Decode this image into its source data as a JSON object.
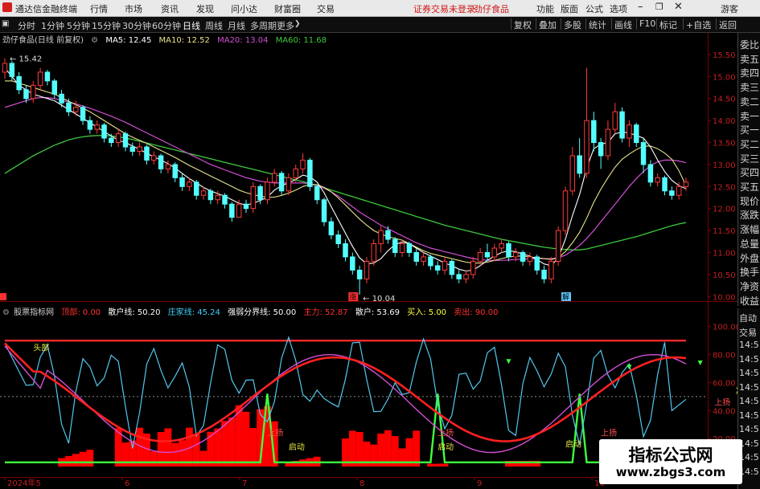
{
  "menubar": {
    "app_title": "通达信金融终端",
    "menus": [
      "行情",
      "市场",
      "资讯",
      "发现",
      "问小达",
      "财富圈",
      "交易"
    ],
    "login_notice": "证券交易未登录",
    "stock_label": "劲仔食品",
    "right_menus": [
      "功能",
      "版面",
      "公式",
      "选项"
    ],
    "window_icons": [
      "minimize-icon",
      "restore-icon",
      "close-icon"
    ],
    "guest": "游客"
  },
  "periodbar": {
    "periods": [
      "分时",
      "1分钟",
      "5分钟",
      "15分钟",
      "30分钟",
      "60分钟",
      "日线",
      "周线",
      "月线",
      "多周期",
      "更多"
    ],
    "active": "日线",
    "tools": [
      "复权",
      "叠加",
      "多股",
      "统计",
      "画线",
      "F10",
      "标记",
      "+自选",
      "返回"
    ]
  },
  "main_chart": {
    "stock_title": "劲仔食品(日线 前复权)",
    "ma": [
      {
        "label": "MA5: 12.45",
        "color": "#ffffff"
      },
      {
        "label": "MA10: 12.52",
        "color": "#e8e38a"
      },
      {
        "label": "MA20: 13.04",
        "color": "#d24fd4"
      },
      {
        "label": "MA60: 11.68",
        "color": "#3ec83e"
      }
    ],
    "price_ticks": [
      "15.50",
      "15.00",
      "14.50",
      "14.00",
      "13.50",
      "13.00",
      "12.50",
      "12.00",
      "11.50",
      "11.00",
      "10.50",
      "10.00"
    ],
    "price_range": [
      9.95,
      15.7
    ],
    "high_label": "15.42",
    "low_label": "10.04",
    "markers": [
      "涨",
      "解",
      "财"
    ],
    "candles": [
      [
        15.1,
        15.3,
        15.42,
        14.95
      ],
      [
        15.3,
        15.0,
        15.35,
        14.9
      ],
      [
        15.0,
        14.7,
        15.1,
        14.6
      ],
      [
        14.7,
        14.5,
        14.8,
        14.4
      ],
      [
        14.5,
        14.8,
        14.9,
        14.4
      ],
      [
        14.8,
        15.1,
        15.2,
        14.7
      ],
      [
        15.1,
        14.9,
        15.15,
        14.8
      ],
      [
        14.9,
        14.6,
        14.95,
        14.5
      ],
      [
        14.6,
        14.4,
        14.7,
        14.3
      ],
      [
        14.4,
        14.2,
        14.5,
        14.1
      ],
      [
        14.2,
        14.3,
        14.45,
        14.1
      ],
      [
        14.3,
        14.0,
        14.35,
        13.9
      ],
      [
        14.0,
        13.8,
        14.1,
        13.7
      ],
      [
        13.8,
        13.9,
        14.0,
        13.7
      ],
      [
        13.9,
        13.6,
        13.95,
        13.5
      ],
      [
        13.6,
        13.5,
        13.7,
        13.4
      ],
      [
        13.5,
        13.7,
        13.8,
        13.4
      ],
      [
        13.7,
        13.4,
        13.75,
        13.3
      ],
      [
        13.4,
        13.3,
        13.5,
        13.2
      ],
      [
        13.3,
        13.4,
        13.5,
        13.2
      ],
      [
        13.4,
        13.1,
        13.45,
        13.0
      ],
      [
        13.1,
        13.2,
        13.3,
        13.0
      ],
      [
        13.2,
        12.9,
        13.25,
        12.8
      ],
      [
        12.9,
        13.0,
        13.1,
        12.8
      ],
      [
        13.0,
        12.7,
        13.05,
        12.6
      ],
      [
        12.7,
        12.5,
        12.8,
        12.4
      ],
      [
        12.5,
        12.6,
        12.7,
        12.4
      ],
      [
        12.6,
        12.3,
        12.65,
        12.2
      ],
      [
        12.3,
        12.4,
        12.5,
        12.2
      ],
      [
        12.4,
        12.2,
        12.45,
        12.1
      ],
      [
        12.2,
        12.3,
        12.4,
        12.1
      ],
      [
        12.3,
        12.1,
        12.35,
        12.0
      ],
      [
        12.1,
        11.8,
        12.15,
        11.7
      ],
      [
        11.8,
        12.1,
        12.2,
        11.8
      ],
      [
        12.1,
        12.0,
        12.2,
        11.9
      ],
      [
        12.0,
        12.5,
        12.6,
        11.9
      ],
      [
        12.5,
        12.2,
        12.55,
        12.1
      ],
      [
        12.2,
        12.6,
        12.7,
        12.1
      ],
      [
        12.6,
        12.8,
        12.9,
        12.5
      ],
      [
        12.8,
        12.4,
        12.85,
        12.3
      ],
      [
        12.4,
        12.7,
        12.8,
        12.3
      ],
      [
        12.7,
        12.9,
        13.0,
        12.6
      ],
      [
        12.9,
        13.1,
        13.25,
        12.8
      ],
      [
        13.1,
        12.5,
        13.15,
        12.4
      ],
      [
        12.5,
        12.2,
        12.55,
        12.1
      ],
      [
        12.2,
        11.7,
        12.25,
        11.6
      ],
      [
        11.7,
        11.4,
        11.8,
        11.3
      ],
      [
        11.4,
        11.2,
        11.5,
        11.1
      ],
      [
        11.2,
        10.9,
        11.3,
        10.8
      ],
      [
        10.9,
        10.6,
        11.0,
        10.5
      ],
      [
        10.6,
        10.4,
        10.7,
        10.04
      ],
      [
        10.4,
        10.8,
        10.9,
        10.3
      ],
      [
        10.8,
        11.2,
        11.3,
        10.7
      ],
      [
        11.2,
        11.5,
        11.6,
        11.0
      ],
      [
        11.5,
        11.3,
        11.6,
        11.2
      ],
      [
        11.3,
        11.0,
        11.35,
        10.9
      ],
      [
        11.0,
        11.2,
        11.3,
        10.9
      ],
      [
        11.2,
        11.0,
        11.25,
        10.9
      ],
      [
        11.0,
        10.8,
        11.1,
        10.7
      ],
      [
        10.8,
        10.9,
        11.0,
        10.7
      ],
      [
        10.9,
        10.7,
        10.95,
        10.6
      ],
      [
        10.7,
        10.6,
        10.8,
        10.5
      ],
      [
        10.6,
        10.8,
        10.9,
        10.5
      ],
      [
        10.8,
        10.5,
        10.85,
        10.4
      ],
      [
        10.5,
        10.4,
        10.6,
        10.3
      ],
      [
        10.4,
        10.5,
        10.6,
        10.3
      ],
      [
        10.5,
        10.8,
        10.9,
        10.4
      ],
      [
        10.8,
        11.0,
        11.1,
        10.7
      ],
      [
        11.0,
        10.9,
        11.2,
        10.8
      ],
      [
        10.9,
        11.1,
        11.2,
        10.8
      ],
      [
        11.1,
        11.2,
        11.3,
        11.0
      ],
      [
        11.2,
        10.9,
        11.25,
        10.8
      ],
      [
        10.9,
        11.0,
        11.1,
        10.8
      ],
      [
        11.0,
        10.8,
        11.05,
        10.7
      ],
      [
        10.8,
        10.9,
        11.0,
        10.7
      ],
      [
        10.9,
        10.6,
        10.95,
        10.5
      ],
      [
        10.6,
        10.4,
        10.7,
        10.3
      ],
      [
        10.4,
        10.8,
        10.9,
        10.3
      ],
      [
        10.8,
        11.5,
        11.6,
        10.7
      ],
      [
        11.5,
        12.4,
        12.5,
        11.4
      ],
      [
        12.4,
        13.2,
        13.4,
        12.3
      ],
      [
        13.2,
        12.8,
        13.6,
        12.7
      ],
      [
        12.8,
        14.0,
        15.2,
        12.7
      ],
      [
        14.0,
        13.5,
        14.2,
        13.3
      ],
      [
        13.5,
        13.2,
        13.6,
        12.9
      ],
      [
        13.2,
        13.8,
        14.0,
        13.1
      ],
      [
        13.8,
        14.2,
        14.4,
        13.7
      ],
      [
        14.2,
        13.6,
        14.3,
        13.5
      ],
      [
        13.6,
        13.9,
        14.0,
        13.4
      ],
      [
        13.9,
        13.5,
        13.95,
        13.4
      ],
      [
        13.5,
        13.0,
        13.6,
        12.8
      ],
      [
        13.0,
        12.6,
        13.1,
        12.5
      ],
      [
        12.6,
        12.7,
        12.8,
        12.5
      ],
      [
        12.7,
        12.4,
        12.75,
        12.3
      ],
      [
        12.4,
        12.3,
        12.5,
        12.2
      ],
      [
        12.3,
        12.5,
        12.6,
        12.2
      ],
      [
        12.5,
        12.6,
        12.7,
        12.4
      ]
    ],
    "ma5": [
      15.2,
      15.0,
      14.8,
      14.7,
      14.6,
      14.55,
      14.5,
      14.45,
      14.35,
      14.25,
      14.15,
      14.05,
      13.95,
      13.85,
      13.75,
      13.65,
      13.55,
      13.5,
      13.42,
      13.35,
      13.25,
      13.18,
      13.1,
      13.02,
      12.92,
      12.8,
      12.68,
      12.58,
      12.48,
      12.4,
      12.34,
      12.28,
      12.2,
      12.12,
      12.08,
      12.12,
      12.18,
      12.26,
      12.42,
      12.52,
      12.58,
      12.66,
      12.76,
      12.72,
      12.6,
      12.36,
      12.04,
      11.74,
      11.44,
      11.14,
      10.88,
      10.74,
      10.76,
      10.86,
      11.04,
      11.18,
      11.24,
      11.2,
      11.1,
      11.0,
      10.92,
      10.84,
      10.76,
      10.7,
      10.62,
      10.58,
      10.6,
      10.7,
      10.82,
      10.92,
      11.0,
      11.04,
      11.02,
      10.96,
      10.92,
      10.84,
      10.74,
      10.7,
      10.88,
      11.3,
      11.84,
      12.32,
      12.92,
      13.36,
      13.46,
      13.5,
      13.7,
      13.74,
      13.72,
      13.66,
      13.6,
      13.4,
      13.1,
      12.84,
      12.64,
      12.52,
      12.45
    ],
    "ma10": [
      14.9,
      14.9,
      14.85,
      14.8,
      14.75,
      14.7,
      14.65,
      14.6,
      14.52,
      14.44,
      14.36,
      14.28,
      14.2,
      14.1,
      14.0,
      13.9,
      13.8,
      13.7,
      13.62,
      13.55,
      13.48,
      13.4,
      13.32,
      13.24,
      13.16,
      13.07,
      12.98,
      12.9,
      12.82,
      12.74,
      12.66,
      12.58,
      12.5,
      12.42,
      12.36,
      12.32,
      12.28,
      12.26,
      12.26,
      12.3,
      12.35,
      12.42,
      12.5,
      12.55,
      12.54,
      12.48,
      12.38,
      12.24,
      12.08,
      11.92,
      11.76,
      11.62,
      11.5,
      11.42,
      11.36,
      11.32,
      11.28,
      11.2,
      11.12,
      11.04,
      10.98,
      10.94,
      10.9,
      10.86,
      10.82,
      10.78,
      10.76,
      10.76,
      10.78,
      10.82,
      10.86,
      10.9,
      10.92,
      10.92,
      10.9,
      10.88,
      10.86,
      10.84,
      10.88,
      11.02,
      11.22,
      11.46,
      11.78,
      12.14,
      12.44,
      12.7,
      12.94,
      13.12,
      13.24,
      13.34,
      13.42,
      13.42,
      13.36,
      13.26,
      13.12,
      12.86,
      12.52
    ],
    "ma20": [
      14.3,
      14.35,
      14.4,
      14.45,
      14.5,
      14.52,
      14.52,
      14.5,
      14.46,
      14.42,
      14.38,
      14.33,
      14.28,
      14.22,
      14.16,
      14.1,
      14.03,
      13.96,
      13.88,
      13.8,
      13.72,
      13.64,
      13.56,
      13.48,
      13.4,
      13.32,
      13.24,
      13.16,
      13.08,
      13.0,
      12.94,
      12.88,
      12.82,
      12.76,
      12.7,
      12.66,
      12.62,
      12.6,
      12.58,
      12.58,
      12.58,
      12.58,
      12.58,
      12.56,
      12.52,
      12.46,
      12.38,
      12.28,
      12.16,
      12.04,
      11.92,
      11.82,
      11.72,
      11.62,
      11.54,
      11.46,
      11.38,
      11.3,
      11.22,
      11.16,
      11.1,
      11.06,
      11.02,
      10.98,
      10.94,
      10.9,
      10.86,
      10.84,
      10.82,
      10.82,
      10.82,
      10.83,
      10.84,
      10.85,
      10.86,
      10.86,
      10.86,
      10.86,
      10.88,
      10.94,
      11.04,
      11.16,
      11.32,
      11.5,
      11.7,
      11.9,
      12.1,
      12.3,
      12.5,
      12.68,
      12.84,
      12.98,
      13.06,
      13.1,
      13.1,
      13.08,
      13.04
    ],
    "ma60": [
      12.8,
      12.9,
      13.0,
      13.1,
      13.2,
      13.28,
      13.36,
      13.44,
      13.5,
      13.56,
      13.6,
      13.63,
      13.65,
      13.66,
      13.66,
      13.65,
      13.63,
      13.6,
      13.57,
      13.53,
      13.49,
      13.45,
      13.41,
      13.37,
      13.33,
      13.29,
      13.25,
      13.21,
      13.17,
      13.13,
      13.09,
      13.05,
      13.01,
      12.97,
      12.93,
      12.89,
      12.85,
      12.81,
      12.77,
      12.73,
      12.69,
      12.65,
      12.61,
      12.57,
      12.52,
      12.47,
      12.42,
      12.37,
      12.32,
      12.27,
      12.22,
      12.17,
      12.12,
      12.07,
      12.02,
      11.97,
      11.92,
      11.87,
      11.82,
      11.77,
      11.72,
      11.67,
      11.62,
      11.58,
      11.54,
      11.5,
      11.46,
      11.42,
      11.38,
      11.34,
      11.3,
      11.27,
      11.24,
      11.21,
      11.18,
      11.15,
      11.12,
      11.1,
      11.08,
      11.07,
      11.06,
      11.06,
      11.08,
      11.12,
      11.16,
      11.2,
      11.24,
      11.28,
      11.32,
      11.36,
      11.41,
      11.46,
      11.51,
      11.56,
      11.61,
      11.65,
      11.68
    ]
  },
  "indicator": {
    "name": "股票指标网",
    "legend": [
      {
        "label": "顶部: 0.00",
        "color": "#ff3030"
      },
      {
        "label": "散户线: 50.20",
        "color": "#ffffff"
      },
      {
        "label": "庄家线: 45.24",
        "color": "#3fd2ff"
      },
      {
        "label": "强弱分界线: 50.00",
        "color": "#ffffff"
      },
      {
        "label": "主力: 52.87",
        "color": "#ff3030"
      },
      {
        "label": "散户: 53.69",
        "color": "#ffffff"
      },
      {
        "label": "买入: 5.00",
        "color": "#ffff40"
      },
      {
        "label": "卖出: 90.00",
        "color": "#ff3030"
      }
    ],
    "y_ticks": [
      "100.00",
      "80.00",
      "60.00",
      "40.00",
      "20.00"
    ],
    "annotations": [
      "头部",
      "上扬",
      "启动",
      "上扬",
      "启动",
      "上扬",
      "启动",
      "上扬",
      "净资"
    ],
    "sell_level": 90,
    "mid_level": 50
  },
  "date_axis": [
    "2024年5",
    "6",
    "7",
    "8",
    "9",
    "10"
  ],
  "quote_panel": {
    "labels": [
      "委比",
      "卖五",
      "卖四",
      "卖三",
      "卖二",
      "卖一",
      "买一",
      "买二",
      "买三",
      "买四",
      "买五",
      "现价",
      "涨跌",
      "涨幅",
      "总量",
      "外盘",
      "换手",
      "净资",
      "收益"
    ]
  },
  "side_buttons": {
    "labels": [
      "自动",
      "交易",
      "14:5",
      "14:5",
      "14:5",
      "14:5",
      "14:5",
      "14:5",
      "14:5",
      "14:5",
      "14:5",
      "14:5"
    ]
  },
  "watermark": {
    "title": "指标公式网",
    "url": "www.zbgs3.com"
  }
}
